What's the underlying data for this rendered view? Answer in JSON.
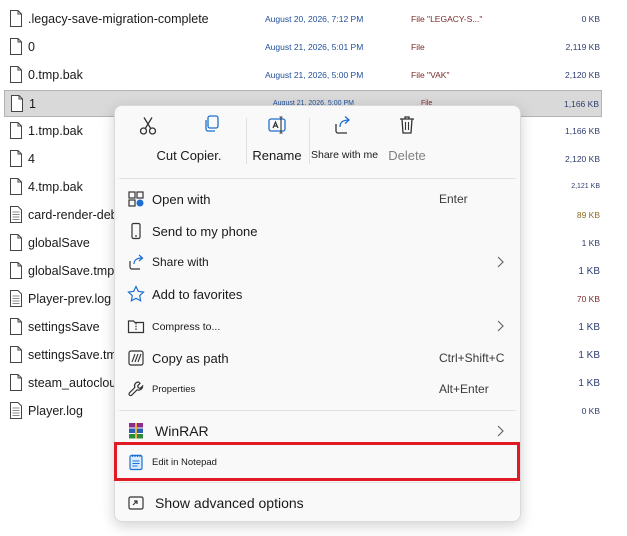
{
  "files": [
    {
      "name": ".legacy-save-migration-complete",
      "date": "August 20, 2026, 7:12 PM",
      "type": "File \"LEGACY-S...\"",
      "size": "0 KB"
    },
    {
      "name": "0",
      "date": "August 21, 2026, 5:01 PM",
      "type": "File",
      "size": "2,119 KB"
    },
    {
      "name": "0.tmp.bak",
      "date": "August 21, 2026, 5:00 PM",
      "type": "File \"VAK\"",
      "size": "2,120 KB"
    },
    {
      "name": "1",
      "date": "August 21, 2026, 5:00 PM",
      "type": "File",
      "size": "1,166 KB"
    },
    {
      "name": "1.tmp.bak",
      "date": "",
      "type": "",
      "size": "1,166 KB"
    },
    {
      "name": "4",
      "date": "",
      "type": "",
      "size": "2,120 KB"
    },
    {
      "name": "4.tmp.bak",
      "date": "",
      "type": "",
      "size": "2,121 KB"
    },
    {
      "name": "card-render-deb",
      "date": "",
      "type": "",
      "size": "89 KB"
    },
    {
      "name": "globalSave",
      "date": "",
      "type": "",
      "size": "1 KB"
    },
    {
      "name": "globalSave.tmp.",
      "date": "",
      "type": "",
      "size": "1 KB"
    },
    {
      "name": "Player-prev.log",
      "date": "",
      "type": "",
      "size": "70 KB"
    },
    {
      "name": "settingsSave",
      "date": "",
      "type": "",
      "size": "1 KB"
    },
    {
      "name": "settingsSave.tmp",
      "date": "",
      "type": "",
      "size": "1 KB"
    },
    {
      "name": "steam_autoclou",
      "date": "",
      "type": "",
      "size": "1 KB"
    },
    {
      "name": "Player.log",
      "date": "",
      "type": "",
      "size": "0 KB"
    }
  ],
  "quick_actions": {
    "cut_copy": "Cut Copier.",
    "rename": "Rename",
    "share": "Share with me",
    "delete": "Delete"
  },
  "menu": {
    "open_with": {
      "label": "Open with",
      "shortcut": "Enter"
    },
    "send_to_phone": {
      "label": "Send to my phone"
    },
    "share_with": {
      "label": "Share with"
    },
    "add_favorites": {
      "label": "Add to favorites"
    },
    "compress": {
      "label": "Compress to..."
    },
    "copy_path": {
      "label": "Copy as path",
      "shortcut": "Ctrl+Shift+C"
    },
    "properties": {
      "label": "Properties",
      "shortcut": "Alt+Enter"
    },
    "winrar": {
      "label": "WinRAR"
    },
    "edit_notepad": {
      "label": "Edit in Notepad"
    },
    "advanced": {
      "label": "Show advanced options"
    }
  },
  "colors": {
    "highlight_border": "#e01b24",
    "selected_row": "#d9d9d9",
    "accent_blue": "#1f6fd1"
  }
}
